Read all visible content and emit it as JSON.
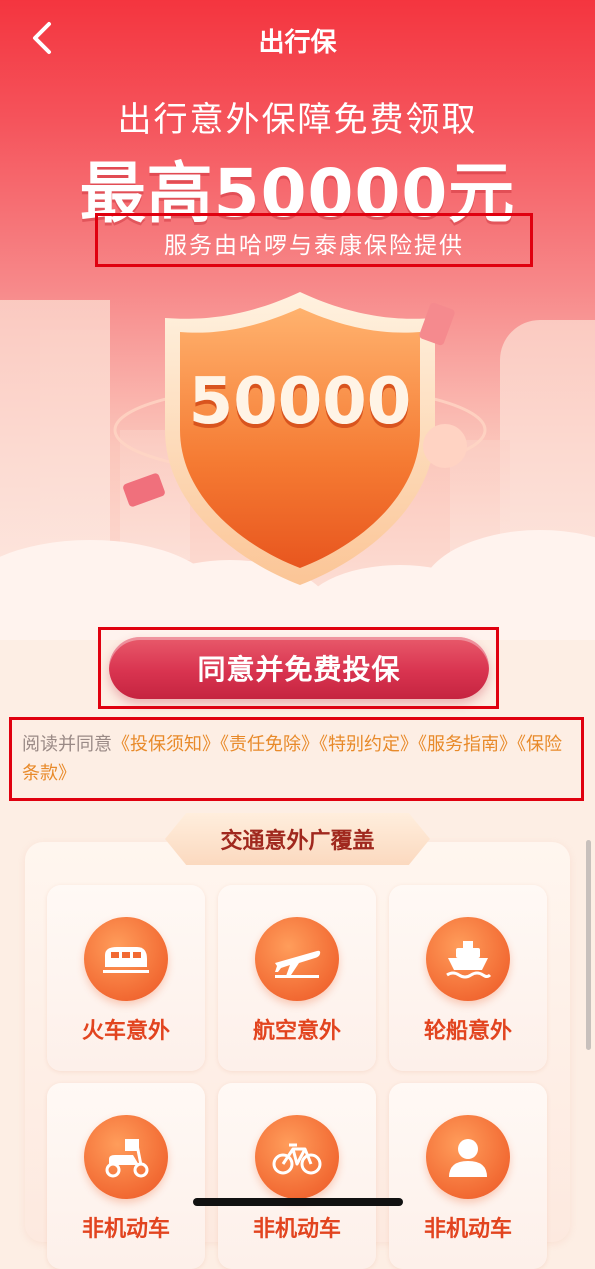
{
  "header": {
    "title": "出行保",
    "back_icon": "chevron-left-icon"
  },
  "hero": {
    "headline": "出行意外保障免费领取",
    "amount": "最高50000元",
    "provider": "服务由哈啰与泰康保险提供",
    "shield_value": "50000"
  },
  "cta": {
    "label": "同意并免费投保"
  },
  "agreement": {
    "prefix": "阅读并同意",
    "docs": [
      "《投保须知》",
      "《责任免除》",
      "《特别约定》",
      "《服务指南》",
      "《保险条款》"
    ]
  },
  "coverage": {
    "title": "交通意外广覆盖",
    "items": [
      {
        "label": "火车意外",
        "icon": "train-icon"
      },
      {
        "label": "航空意外",
        "icon": "airplane-icon"
      },
      {
        "label": "轮船意外",
        "icon": "ship-icon"
      },
      {
        "label": "非机动车",
        "icon": "scooter-icon"
      },
      {
        "label": "非机动车",
        "icon": "bicycle-icon"
      },
      {
        "label": "非机动车",
        "icon": "person-icon"
      }
    ]
  },
  "colors": {
    "accent": "#f4353f",
    "cta": "#d93450",
    "link": "#e88a2a",
    "item_label": "#e2441f"
  }
}
